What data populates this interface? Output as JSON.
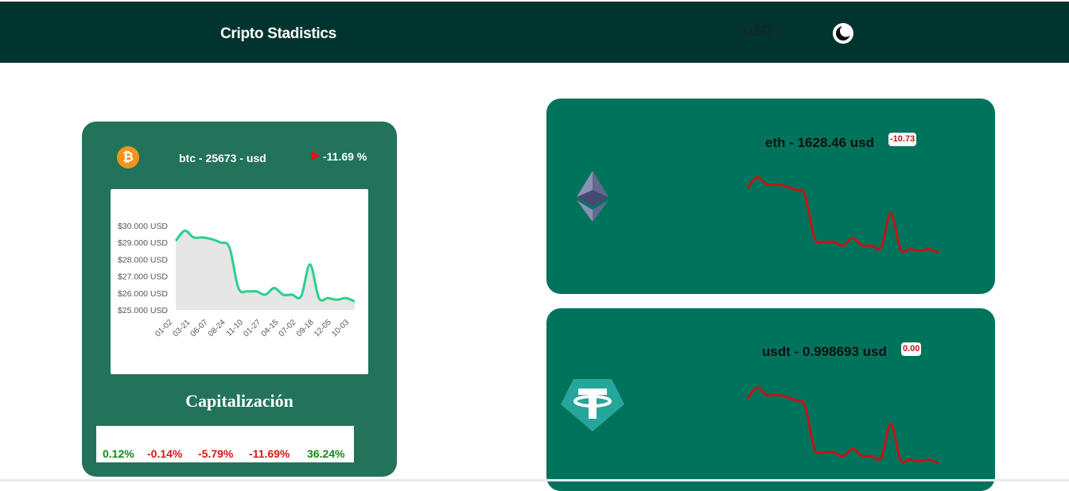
{
  "header": {
    "brand": "Cripto Stadistics",
    "currency": "USD",
    "theme_icon": "moon-icon"
  },
  "btc": {
    "icon": "bitcoin-icon",
    "title": "btc - 25673 - usd",
    "change": "-11.69 %",
    "trend_icon": "red-flag-icon",
    "chart_data": {
      "type": "area",
      "x": [
        "01-02",
        "03-21",
        "06-07",
        "08-24",
        "11-10",
        "01-27",
        "04-15",
        "07-02",
        "09-18",
        "12-05",
        "10-03"
      ],
      "y_ticks": [
        "$30.000 USD",
        "$29.000 USD",
        "$28.000 USD",
        "$27.000 USD",
        "$26.000 USD",
        "$25.000 USD"
      ],
      "ylim": [
        25000,
        30000
      ],
      "series": [
        {
          "values": [
            29100,
            29700,
            29300,
            29300,
            29200,
            29000,
            28700,
            26300,
            26100,
            26100,
            25900,
            26300,
            25900,
            25900,
            25800,
            27700,
            25700,
            25700,
            25600,
            25700,
            25500
          ]
        }
      ],
      "line_color": "#2bd08d",
      "fill_color": "#e6e6e6"
    }
  },
  "capitalization": {
    "title": "Capitalización",
    "values": [
      {
        "text": "0.12%",
        "sign": "pos"
      },
      {
        "text": "-0.14%",
        "sign": "neg"
      },
      {
        "text": "-5.79%",
        "sign": "neg"
      },
      {
        "text": "-11.69%",
        "sign": "neg"
      },
      {
        "text": "36.24%",
        "sign": "pos"
      }
    ]
  },
  "eth": {
    "icon": "ethereum-icon",
    "title": "eth - 1628.46 usd",
    "badge": "-10.73",
    "sparkline": [
      29100,
      29700,
      29300,
      29300,
      29200,
      29000,
      28700,
      26300,
      26100,
      26100,
      25900,
      26300,
      25900,
      25900,
      25800,
      27700,
      25700,
      25700,
      25600,
      25700,
      25500
    ]
  },
  "usdt": {
    "icon": "tether-icon",
    "title": "usdt - 0.998693 usd",
    "badge": "0.00",
    "sparkline": [
      29100,
      29700,
      29300,
      29300,
      29200,
      29000,
      28700,
      26300,
      26100,
      26100,
      25900,
      26300,
      25900,
      25900,
      25800,
      27700,
      25700,
      25700,
      25600,
      25700,
      25500
    ]
  },
  "colors": {
    "header_bg": "#01342e",
    "btc_card_bg": "#22735a",
    "coin_card_bg": "#00735d",
    "spark_color": "#c41414"
  }
}
